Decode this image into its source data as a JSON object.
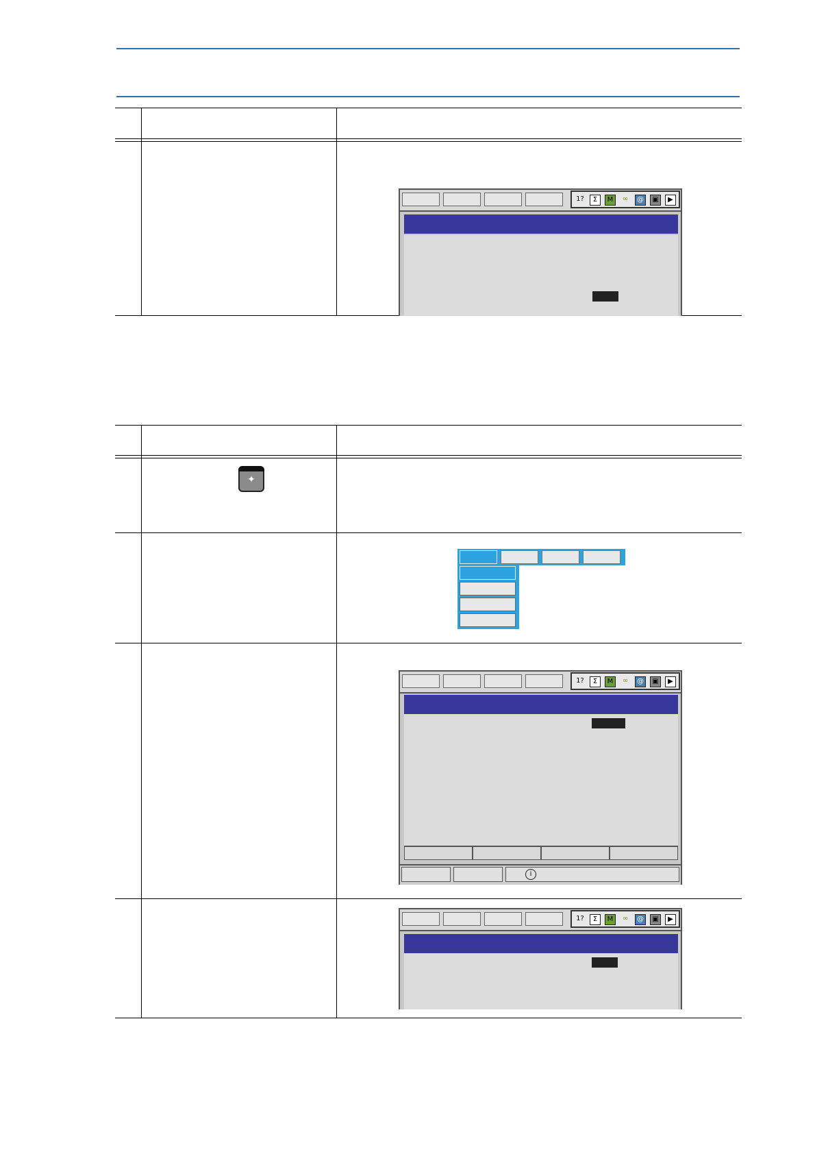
{
  "header": {
    "title": ""
  },
  "table1": {
    "col_step": "",
    "col_operation": "",
    "col_explanation": ""
  },
  "table2": {
    "col_step": "",
    "col_operation": "",
    "col_explanation": ""
  },
  "key": {
    "glyph": "✦"
  },
  "screen_icons": [
    "1?",
    "Σ",
    "M",
    "∞",
    "@",
    "▣",
    "▶"
  ],
  "colors": {
    "rule_blue": "#2f6fb3",
    "title_bar": "#37379a",
    "menu_highlight": "#2aa3e0"
  }
}
